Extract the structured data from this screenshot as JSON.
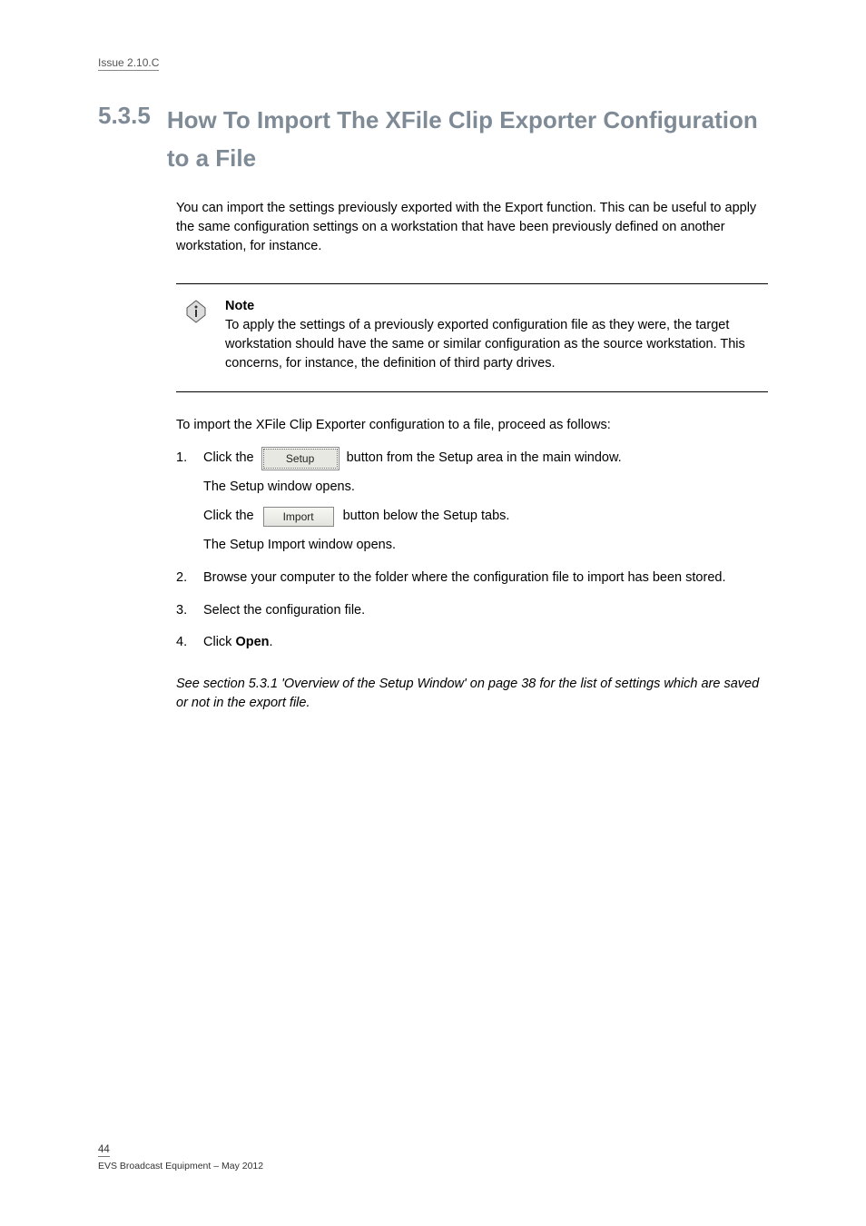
{
  "header": {
    "issue": "Issue 2.10.C"
  },
  "heading": {
    "number": "5.3.5",
    "title": "How To Import The XFile Clip Exporter Configuration to a File"
  },
  "intro": "You can import the settings previously exported with the Export function. This can be useful to apply the same configuration settings on a workstation that have been previously defined on another workstation, for instance.",
  "note": {
    "label": "Note",
    "text": "To apply the settings of a previously exported configuration file as they were, the target workstation should have the same or similar configuration as the source workstation. This concerns, for instance, the definition of third party drives."
  },
  "steps_intro": "To import the XFile Clip Exporter configuration to a file, proceed as follows:",
  "steps": [
    {
      "num": "1.",
      "text_pre": "Click the",
      "btn": "Setup",
      "text_post": "button from the Setup area in the main window.",
      "after_para_1": "The Setup window opens.",
      "after_para_2_pre": "Click the",
      "after_btn": "Import",
      "after_para_2_post": "button below the Setup tabs.",
      "after_para_3": "The Setup Import window opens."
    },
    {
      "num": "2.",
      "text": "Browse your computer to the folder where the configuration file to import has been stored."
    },
    {
      "num": "3.",
      "text": "Select the configuration file."
    },
    {
      "num": "4.",
      "text_pre": "Click ",
      "bold": "Open",
      "text_post": "."
    }
  ],
  "closing": "See section 5.3.1 'Overview of the Setup Window' on page 38 for the list of settings which are saved or not in the export file.",
  "footer": {
    "line": "44",
    "sub": "EVS Broadcast Equipment – May 2012"
  }
}
